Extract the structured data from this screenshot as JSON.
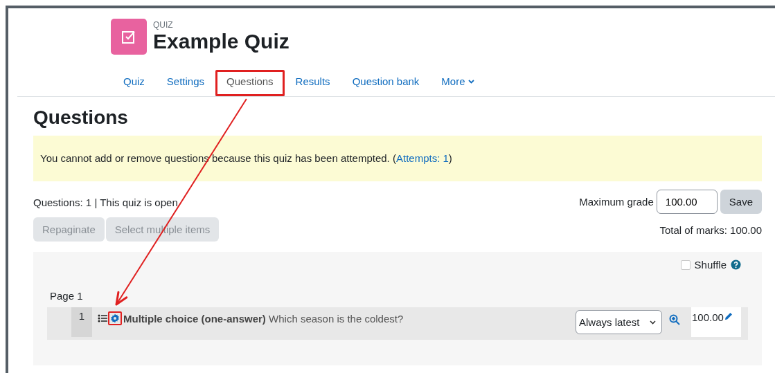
{
  "activity": {
    "kind_label": "QUIZ",
    "title": "Example Quiz"
  },
  "tabs": [
    {
      "label": "Quiz",
      "selected": false,
      "kind": "link"
    },
    {
      "label": "Settings",
      "selected": false,
      "kind": "link"
    },
    {
      "label": "Questions",
      "selected": true,
      "kind": "link",
      "highlighted": true
    },
    {
      "label": "Results",
      "selected": false,
      "kind": "link"
    },
    {
      "label": "Question bank",
      "selected": false,
      "kind": "link"
    },
    {
      "label": "More",
      "selected": false,
      "kind": "menu"
    }
  ],
  "heading": "Questions",
  "notice": {
    "text": "You cannot add or remove questions because this quiz has been attempted. (",
    "link": "Attempts: 1",
    "suffix": ")"
  },
  "summary": "Questions: 1 | This quiz is open",
  "max_grade": {
    "label": "Maximum grade",
    "value": "100.00",
    "button": "Save"
  },
  "actions": [
    {
      "label": "Repaginate",
      "disabled": true
    },
    {
      "label": "Select multiple items",
      "disabled": true
    }
  ],
  "total_marks": "Total of marks: 100.00",
  "shuffle": {
    "label": "Shuffle",
    "checked": false
  },
  "pages": [
    {
      "label": "Page 1",
      "questions": [
        {
          "number": "1",
          "text": "**Multiple choice (one-answer)** Which season is the coldest?",
          "version": "Always latest",
          "mark": "100.00",
          "gear_highlighted": true
        }
      ]
    }
  ],
  "annotation_arrow": true
}
